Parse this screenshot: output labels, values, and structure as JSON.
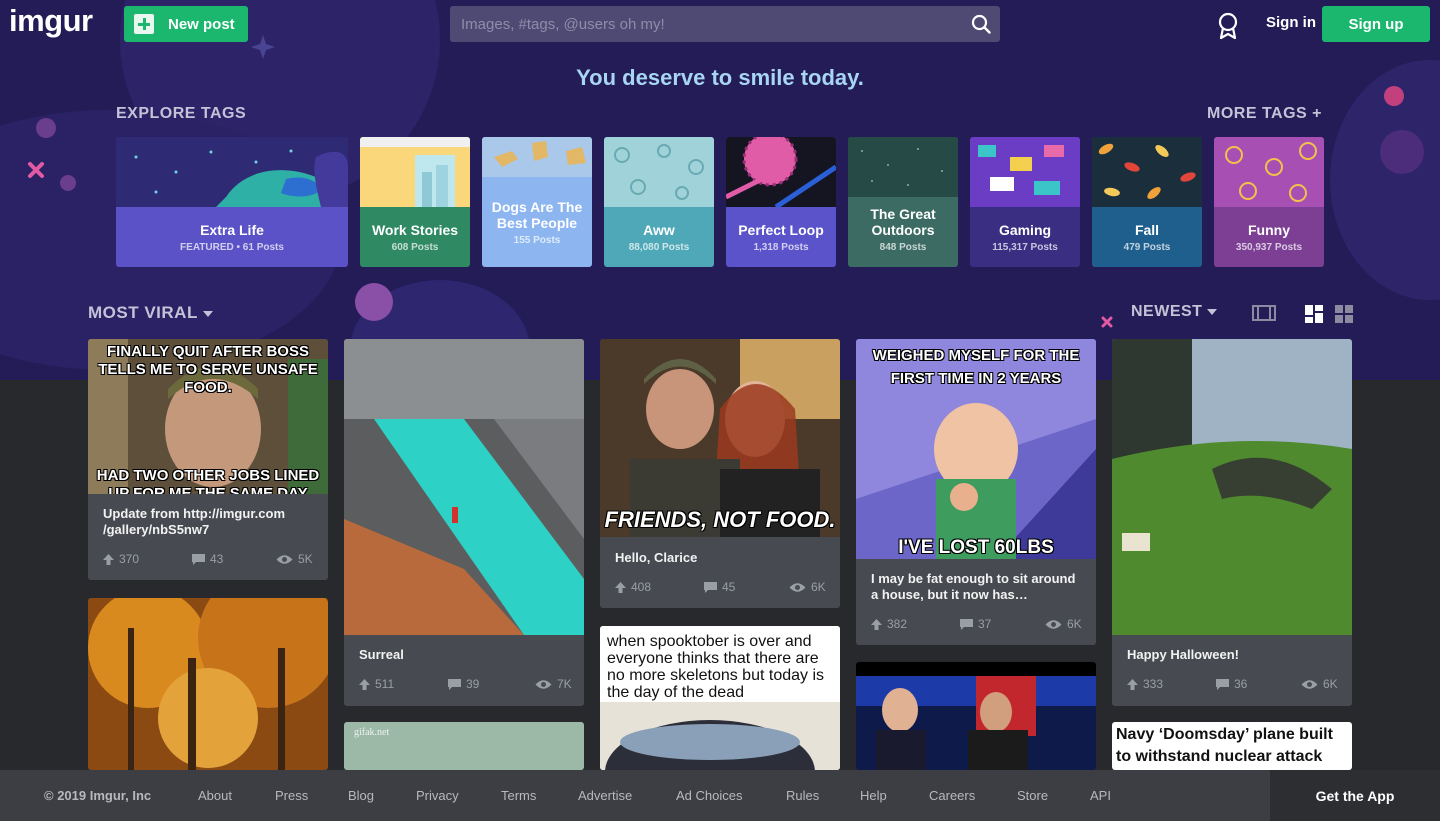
{
  "header": {
    "logo": "imgur",
    "new_post": "New post",
    "search_placeholder": "Images, #tags, @users oh my!",
    "sign_in": "Sign in",
    "sign_up": "Sign up"
  },
  "hero": {
    "tagline": "You deserve to smile today.",
    "explore_tags": "EXPLORE TAGS",
    "more_tags": "MORE TAGS +"
  },
  "tags": [
    {
      "name": "Extra Life",
      "count": "FEATURED • 61 Posts",
      "color": "#5b52c7"
    },
    {
      "name": "Work Stories",
      "count": "608 Posts",
      "color": "#2f8a63"
    },
    {
      "name": "Dogs Are The Best People",
      "count": "155 Posts",
      "color": "#8db6f0"
    },
    {
      "name": "Aww",
      "count": "88,080 Posts",
      "color": "#4fa8b7"
    },
    {
      "name": "Perfect Loop",
      "count": "1,318 Posts",
      "color": "#5b53c9"
    },
    {
      "name": "The Great Outdoors",
      "count": "848 Posts",
      "color": "#3c6b63"
    },
    {
      "name": "Gaming",
      "count": "115,317 Posts",
      "color": "#3a2e83"
    },
    {
      "name": "Fall",
      "count": "479 Posts",
      "color": "#1f5f8e"
    },
    {
      "name": "Funny",
      "count": "350,937 Posts",
      "color": "#7c3f94"
    }
  ],
  "sort": {
    "section": "MOST VIRAL",
    "order": "NEWEST"
  },
  "posts": [
    {
      "title": "Update from http://imgur.com /gallery/nbS5nw7",
      "image_text_top": "FINALLY QUIT AFTER BOSS TELLS ME TO SERVE UNSAFE FOOD.",
      "image_text_bottom": "HAD TWO OTHER JOBS LINED UP FOR ME THE SAME DAY",
      "ups": "370",
      "comments": "43",
      "views": "5K"
    },
    {
      "title": "Surreal",
      "ups": "511",
      "comments": "39",
      "views": "7K"
    },
    {
      "title": "Hello, Clarice",
      "image_text": "FRIENDS, NOT FOOD.",
      "ups": "408",
      "comments": "45",
      "views": "6K"
    },
    {
      "title": "I may be fat enough to sit around a house, but it now has…",
      "image_text_top": "WEIGHED MYSELF FOR THE FIRST TIME IN 2 YEARS",
      "image_text_bottom": "I'VE LOST 60LBS",
      "ups": "382",
      "comments": "37",
      "views": "6K"
    },
    {
      "title": "Happy Halloween!",
      "ups": "333",
      "comments": "36",
      "views": "6K"
    },
    {
      "image_text": "when spooktober is over and everyone thinks that there are no more skeletons but today is the day of the dead"
    },
    {
      "image_text": "gifak.net"
    },
    {
      "image_text": "Navy ‘Doomsday’ plane built to withstand nuclear attack"
    }
  ],
  "footer": {
    "copyright": "© 2019 Imgur, Inc",
    "links": [
      "About",
      "Press",
      "Blog",
      "Privacy",
      "Terms",
      "Advertise",
      "Ad Choices",
      "Rules",
      "Help",
      "Careers",
      "Store",
      "API"
    ],
    "get_app": "Get the App"
  },
  "colors": {
    "hero_bg": "#231c57",
    "brand_green": "#1bb76e",
    "feed_bg": "#27292d",
    "card_bg": "#474a51",
    "tagline": "#a8d5f3"
  }
}
